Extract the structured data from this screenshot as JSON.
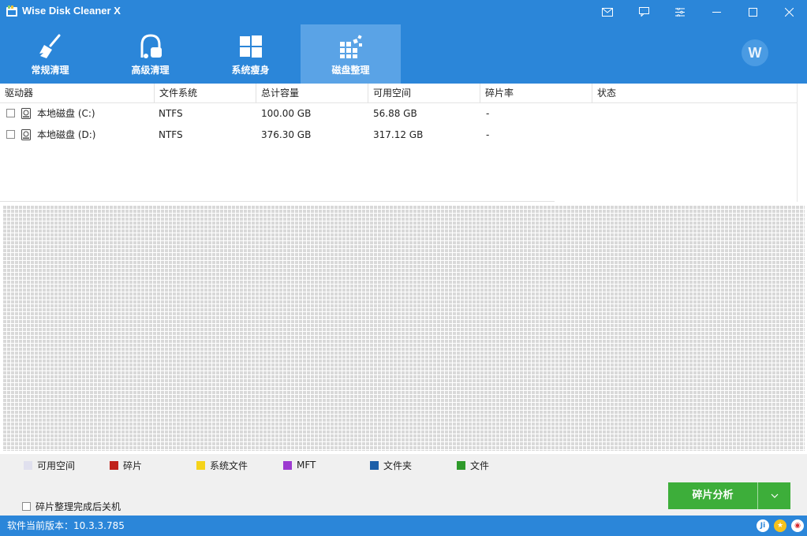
{
  "app": {
    "title": "Wise Disk Cleaner X"
  },
  "nav": [
    {
      "label": "常规清理",
      "icon": "broom-icon",
      "active": false
    },
    {
      "label": "高级清理",
      "icon": "vacuum-icon",
      "active": false
    },
    {
      "label": "系统瘦身",
      "icon": "windows-icon",
      "active": false
    },
    {
      "label": "磁盘整理",
      "icon": "defrag-blocks-icon",
      "active": true
    }
  ],
  "avatar": {
    "letter": "W"
  },
  "table": {
    "columns": [
      "驱动器",
      "文件系统",
      "总计容量",
      "可用空间",
      "碎片率",
      "状态"
    ],
    "rows": [
      {
        "drive": "本地磁盘 (C:)",
        "fs": "NTFS",
        "total": "100.00 GB",
        "free": "56.88 GB",
        "frag": "-",
        "status": "",
        "checked": false
      },
      {
        "drive": "本地磁盘 (D:)",
        "fs": "NTFS",
        "total": "376.30 GB",
        "free": "317.12 GB",
        "frag": "-",
        "status": "",
        "checked": false
      }
    ]
  },
  "legend": [
    {
      "label": "可用空间",
      "color": "#e0e0ee"
    },
    {
      "label": "碎片",
      "color": "#c0221a"
    },
    {
      "label": "系统文件",
      "color": "#f5d31a"
    },
    {
      "label": "MFT",
      "color": "#9c3ad0"
    },
    {
      "label": "文件夹",
      "color": "#1d5fa8"
    },
    {
      "label": "文件",
      "color": "#2e9a2a"
    }
  ],
  "options": {
    "shutdown_label": "碎片整理完成后关机",
    "shutdown_checked": false
  },
  "actions": {
    "analyze_label": "碎片分析"
  },
  "status": {
    "version_text": "软件当前版本：10.3.3.785"
  },
  "colors": {
    "accent": "#2b86d9",
    "nav_active": "#5aa3e6",
    "button_green": "#3dae3a"
  }
}
